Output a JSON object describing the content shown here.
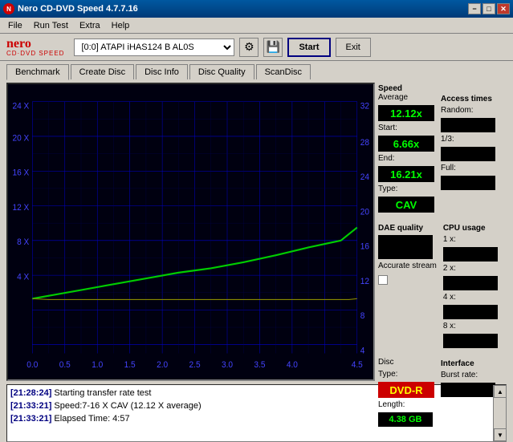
{
  "titlebar": {
    "title": "Nero CD-DVD Speed 4.7.7.16",
    "controls": [
      "minimize",
      "maximize",
      "close"
    ]
  },
  "menu": {
    "items": [
      "File",
      "Run Test",
      "Extra",
      "Help"
    ]
  },
  "toolbar": {
    "logo_top": "nero",
    "logo_bottom": "CD·DVD SPEED",
    "drive_value": "[0:0]  ATAPI iHAS124  B AL0S",
    "start_label": "Start",
    "exit_label": "Exit"
  },
  "tabs": {
    "items": [
      "Benchmark",
      "Create Disc",
      "Disc Info",
      "Disc Quality",
      "ScanDisc"
    ],
    "active": 0
  },
  "chart": {
    "x_labels": [
      "0.0",
      "0.5",
      "1.0",
      "1.5",
      "2.0",
      "2.5",
      "3.0",
      "3.5",
      "4.0",
      "4.5"
    ],
    "y_left_labels": [
      "4 X",
      "8 X",
      "12 X",
      "16 X",
      "20 X",
      "24 X"
    ],
    "y_right_labels": [
      "4",
      "8",
      "12",
      "16",
      "20",
      "24",
      "28",
      "32"
    ]
  },
  "speed_panel": {
    "title": "Speed",
    "average_label": "Average",
    "average_value": "12.12x",
    "start_label": "Start:",
    "start_value": "6.66x",
    "end_label": "End:",
    "end_value": "16.21x",
    "type_label": "Type:",
    "type_value": "CAV"
  },
  "access_times": {
    "title": "Access times",
    "random_label": "Random:",
    "random_value": "",
    "onethird_label": "1/3:",
    "onethird_value": "",
    "full_label": "Full:",
    "full_value": ""
  },
  "cpu_usage": {
    "title": "CPU usage",
    "1x_label": "1 x:",
    "1x_value": "",
    "2x_label": "2 x:",
    "2x_value": "",
    "4x_label": "4 x:",
    "4x_value": "",
    "8x_label": "8 x:",
    "8x_value": ""
  },
  "dae_quality": {
    "title": "DAE quality",
    "value": "",
    "accurate_stream_label": "Accurate stream",
    "accurate_stream_checked": false
  },
  "disc_info": {
    "type_label": "Disc",
    "type_sublabel": "Type:",
    "type_value": "DVD-R",
    "length_label": "Length:",
    "length_value": "4.38 GB"
  },
  "interface": {
    "title": "Interface",
    "burst_label": "Burst rate:"
  },
  "log": {
    "lines": [
      {
        "time": "[21:28:24]",
        "text": "Starting transfer rate test"
      },
      {
        "time": "[21:33:21]",
        "text": "Speed:7-16 X CAV (12.12 X average)"
      },
      {
        "time": "[21:33:21]",
        "text": "Elapsed Time: 4:57"
      }
    ]
  }
}
